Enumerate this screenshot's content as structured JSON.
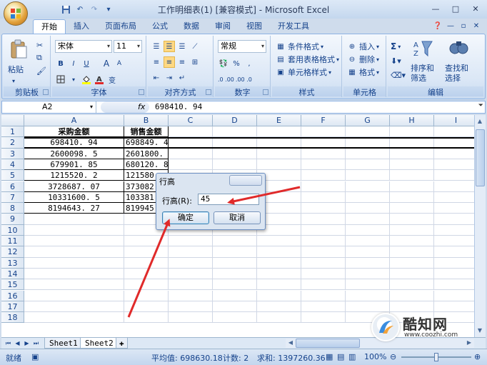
{
  "window": {
    "title": "工作明细表(1) [兼容模式] - Microsoft Excel",
    "controls": [
      "—",
      "□",
      "✕"
    ]
  },
  "tabs": [
    "开始",
    "插入",
    "页面布局",
    "公式",
    "数据",
    "审阅",
    "视图",
    "开发工具"
  ],
  "ribbon": {
    "clipboard": {
      "label": "剪贴板",
      "paste": "粘贴"
    },
    "font": {
      "label": "字体",
      "name": "宋体",
      "size": "11",
      "bold": "B",
      "italic": "I",
      "underline": "U",
      "grow": "A",
      "shrink": "A",
      "phonetic": "变"
    },
    "alignment": {
      "label": "对齐方式"
    },
    "number": {
      "label": "数字",
      "format": "常规",
      "percent": "%",
      "comma": ",",
      "inc_decimal": ".0 .00",
      "dec_decimal": ".00 .0"
    },
    "styles": {
      "label": "样式",
      "conditional": "条件格式",
      "table": "套用表格格式",
      "cell_styles": "单元格样式"
    },
    "cells": {
      "label": "单元格",
      "insert": "插入",
      "delete": "删除",
      "format": "格式"
    },
    "editing": {
      "label": "编辑",
      "sum": "Σ",
      "sort_filter_1": "排序和",
      "sort_filter_2": "筛选",
      "find_1": "查找和",
      "find_2": "选择"
    }
  },
  "formula_bar": {
    "name_box": "A2",
    "fx": "fx",
    "value": "698410. 94"
  },
  "columns": [
    "A",
    "B",
    "C",
    "D",
    "E",
    "F",
    "G",
    "H",
    "I"
  ],
  "rows": [
    "1",
    "2",
    "3",
    "4",
    "5",
    "6",
    "7",
    "8",
    "9",
    "10",
    "11",
    "12",
    "13",
    "14",
    "15",
    "16",
    "17",
    "18"
  ],
  "table": {
    "headers": [
      "采购金额",
      "销售金额"
    ],
    "a": [
      "698410. 94",
      "2600098. 5",
      "679901. 85",
      "1215520. 2",
      "3728687. 07",
      "10331600. 5",
      "8194643. 27"
    ],
    "b": [
      "698849. 4",
      "2601800.",
      "680120. 8",
      "121580",
      "373082",
      "103381",
      "819945"
    ]
  },
  "sheets": [
    "Sheet1",
    "Sheet2"
  ],
  "status": {
    "ready": "就绪",
    "average": "平均值: 698630.18",
    "count": "计数: 2",
    "sum": "求和: 1397260.36",
    "zoom": "100%"
  },
  "dialog": {
    "title": "行高",
    "label": "行高(R):",
    "value": "45",
    "ok": "确定",
    "cancel": "取消"
  },
  "watermark": {
    "brand": "酷知网",
    "url": "www.coozhi.com"
  },
  "colors": {
    "arrow": "#e02a2a",
    "ribbon_bg": "#dbe7f6",
    "accent": "#15428b"
  }
}
